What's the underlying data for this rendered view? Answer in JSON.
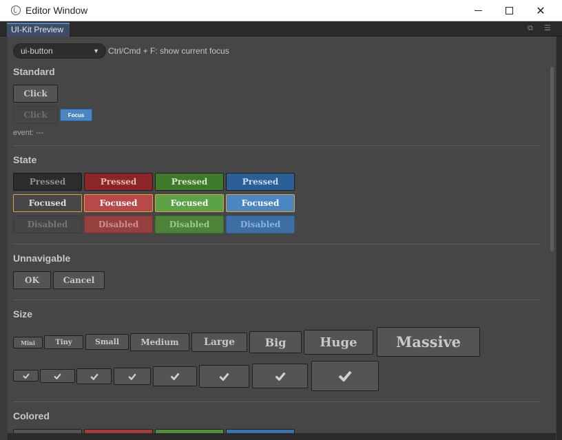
{
  "window": {
    "title": "Editor Window",
    "minimize_glyph": "",
    "close_glyph": "✕"
  },
  "tabs": {
    "active_label": "UI-Kit Preview",
    "popout_glyph": "⧉",
    "menu_glyph": "☰"
  },
  "toolbar": {
    "select_value": "ui-button",
    "select_caret": "▼",
    "hint": "Ctrl/Cmd + F: show current focus"
  },
  "sections": {
    "standard": "Standard",
    "state": "State",
    "unnavigable": "Unnavigable",
    "size": "Size",
    "colored": "Colored"
  },
  "standard": {
    "click_label": "Click",
    "click_disabled_label": "Click",
    "focus_label": "Focus",
    "event_text": "event: ---"
  },
  "state": {
    "pressed": "Pressed",
    "focused": "Focused",
    "disabled": "Disabled"
  },
  "unnavigable": {
    "ok": "OK",
    "cancel": "Cancel"
  },
  "size": {
    "mini": "Mini",
    "tiny": "Tiny",
    "small": "Small",
    "medium": "Medium",
    "large": "Large",
    "big": "Big",
    "huge": "Huge",
    "massive": "Massive"
  },
  "colors": {
    "default": "#545454",
    "red": "#a83a3a",
    "green": "#4f8f3a",
    "blue": "#3a74b0",
    "focus_outline": "#e5a03c"
  }
}
